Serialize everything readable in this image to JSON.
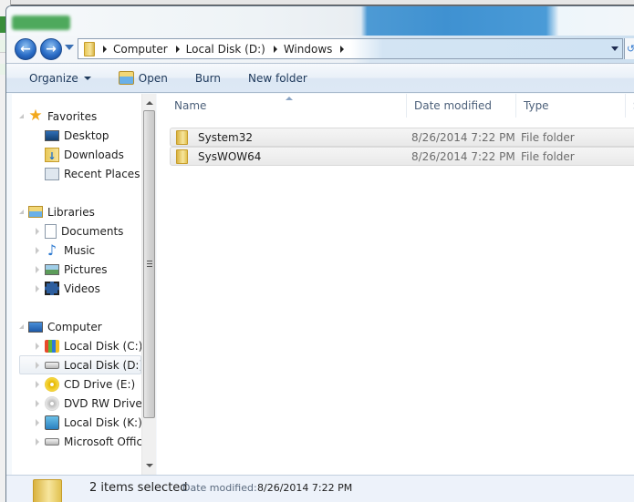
{
  "navigation": {
    "back_icon": "arrow-left-icon",
    "forward_icon": "arrow-right-icon",
    "breadcrumbs": [
      "Computer",
      "Local Disk (D:)",
      "Windows"
    ]
  },
  "toolbar": {
    "organize_label": "Organize",
    "open_label": "Open",
    "burn_label": "Burn",
    "new_folder_label": "New folder"
  },
  "sidebar": {
    "favorites": {
      "label": "Favorites",
      "items": [
        {
          "label": "Desktop",
          "icon": "desktop-icon"
        },
        {
          "label": "Downloads",
          "icon": "downloads-icon"
        },
        {
          "label": "Recent Places",
          "icon": "recent-places-icon"
        }
      ]
    },
    "libraries": {
      "label": "Libraries",
      "items": [
        {
          "label": "Documents",
          "icon": "documents-icon"
        },
        {
          "label": "Music",
          "icon": "music-icon"
        },
        {
          "label": "Pictures",
          "icon": "pictures-icon"
        },
        {
          "label": "Videos",
          "icon": "videos-icon"
        }
      ]
    },
    "computer": {
      "label": "Computer",
      "items": [
        {
          "label": "Local Disk (C:)",
          "icon": "system-drive-icon"
        },
        {
          "label": "Local Disk (D:)",
          "icon": "drive-icon",
          "selected": true
        },
        {
          "label": "CD Drive (E:)",
          "icon": "cd-drive-icon"
        },
        {
          "label": "DVD RW Drive (F:",
          "icon": "dvd-drive-icon"
        },
        {
          "label": "Local Disk (K:)",
          "icon": "drive-icon"
        },
        {
          "label": "Microsoft Office",
          "icon": "drive-icon"
        }
      ]
    }
  },
  "filelist": {
    "columns": [
      "Name",
      "Date modified",
      "Type",
      "S"
    ],
    "sort_column": "Name",
    "rows": [
      {
        "name": "System32",
        "date": "8/26/2014 7:22 PM",
        "type": "File folder",
        "selected": true
      },
      {
        "name": "SysWOW64",
        "date": "8/26/2014 7:22 PM",
        "type": "File folder",
        "selected": true
      }
    ]
  },
  "details": {
    "count": "2 items selected",
    "date_label": "Date modified:",
    "date_value": "8/26/2014 7:22 PM"
  }
}
